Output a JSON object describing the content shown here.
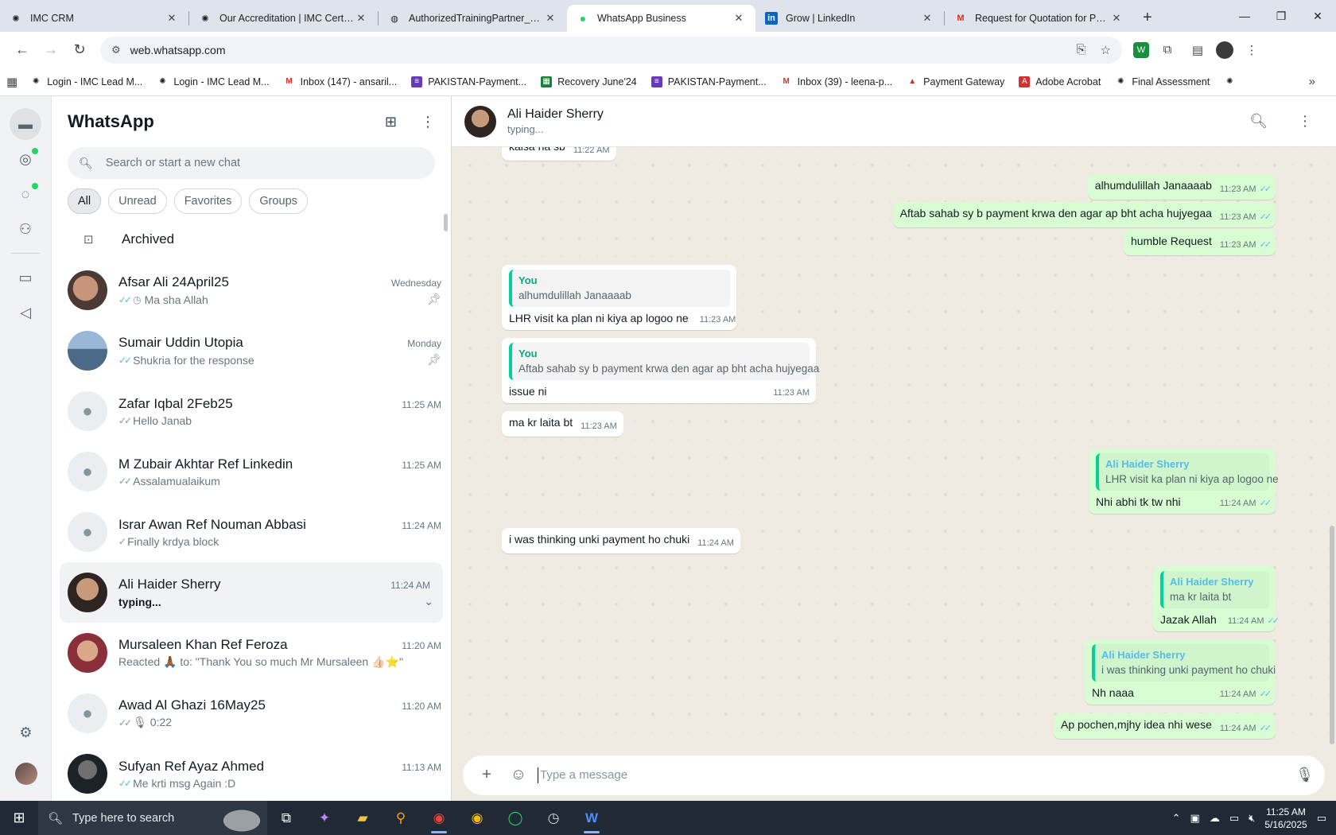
{
  "browser": {
    "tabs": [
      {
        "title": "IMC CRM",
        "icon": "spiral-icon",
        "active": false
      },
      {
        "title": "Our Accreditation | IMC Certific",
        "icon": "spiral-icon",
        "active": false
      },
      {
        "title": "AuthorizedTrainingPartner_Bad",
        "icon": "globe-icon",
        "active": false
      },
      {
        "title": "WhatsApp Business",
        "icon": "whatsapp-icon",
        "active": true
      },
      {
        "title": "Grow | LinkedIn",
        "icon": "linkedin-icon",
        "active": false
      },
      {
        "title": "Request for Quotation for PMP",
        "icon": "gmail-icon",
        "active": false
      }
    ],
    "url": "web.whatsapp.com",
    "bookmarks": [
      {
        "label": "Login - IMC Lead M...",
        "icon": "spiral-icon"
      },
      {
        "label": "Login - IMC Lead M...",
        "icon": "spiral-icon"
      },
      {
        "label": "Inbox (147) - ansaril...",
        "icon": "gmail-icon"
      },
      {
        "label": "PAKISTAN-Payment...",
        "icon": "form-icon"
      },
      {
        "label": "Recovery June'24",
        "icon": "sheet-icon"
      },
      {
        "label": "PAKISTAN-Payment...",
        "icon": "form-icon"
      },
      {
        "label": "Inbox (39) - leena-p...",
        "icon": "gmail-icon"
      },
      {
        "label": "Payment Gateway",
        "icon": "acrobat-icon"
      },
      {
        "label": "Adobe Acrobat",
        "icon": "acrobat-icon"
      },
      {
        "label": "Final Assessment",
        "icon": "spiral-icon"
      }
    ]
  },
  "sidebar": {
    "title": "WhatsApp",
    "search_placeholder": "Search or start a new chat",
    "filters": [
      "All",
      "Unread",
      "Favorites",
      "Groups"
    ],
    "archived_label": "Archived",
    "chats": [
      {
        "name": "Afsar Ali 24April25",
        "time": "Wednesday",
        "preview": "Ma sha Allah",
        "tick": "blue",
        "pinned": true,
        "avatar": "photo"
      },
      {
        "name": "Sumair Uddin Utopia",
        "time": "Monday",
        "preview": "Shukria for the response",
        "tick": "blue",
        "pinned": true,
        "avatar": "photo"
      },
      {
        "name": "Zafar Iqbal 2Feb25",
        "time": "11:25 AM",
        "preview": "Hello Janab",
        "tick": "grey",
        "pinned": false,
        "avatar": "placeholder"
      },
      {
        "name": "M Zubair Akhtar Ref Linkedin",
        "time": "11:25 AM",
        "preview": "Assalamualaikum",
        "tick": "grey",
        "pinned": false,
        "avatar": "placeholder"
      },
      {
        "name": "Israr Awan Ref Nouman Abbasi",
        "time": "11:24 AM",
        "preview": "Finally krdya block",
        "tick": "single",
        "pinned": false,
        "avatar": "placeholder"
      },
      {
        "name": "Ali Haider Sherry",
        "time": "11:24 AM",
        "preview": "typing...",
        "tick": "none",
        "pinned": false,
        "avatar": "photo",
        "selected": true
      },
      {
        "name": "Mursaleen Khan Ref Feroza",
        "time": "11:20 AM",
        "preview": "Reacted 🙏🏾 to: \"Thank You so much Mr Mursaleen 👍🏻⭐\"",
        "tick": "none",
        "pinned": false,
        "avatar": "photo"
      },
      {
        "name": "Awad Al Ghazi 16May25",
        "time": "11:20 AM",
        "preview": "🎙 0:22",
        "tick": "grey",
        "pinned": false,
        "avatar": "placeholder"
      },
      {
        "name": "Sufyan Ref Ayaz Ahmed",
        "time": "11:13 AM",
        "preview": "Me krti msg Again :D",
        "tick": "blue",
        "pinned": false,
        "avatar": "photo"
      }
    ]
  },
  "conversation": {
    "contact_name": "Ali Haider Sherry",
    "contact_status": "typing...",
    "composer_placeholder": "Type a message",
    "messages": [
      {
        "dir": "in",
        "text": "kaisa ha sb",
        "time": "11:22 AM"
      },
      {
        "dir": "out",
        "text": "alhumdulillah Janaaaab",
        "time": "11:23 AM"
      },
      {
        "dir": "out",
        "text": "Aftab sahab sy b payment krwa den agar ap bht acha hujyegaa",
        "time": "11:23 AM"
      },
      {
        "dir": "out",
        "text": "humble Request",
        "time": "11:23 AM"
      },
      {
        "dir": "in",
        "quote_name": "You",
        "quote_text": "alhumdulillah Janaaaab",
        "text": "LHR visit ka plan ni kiya ap logoo ne",
        "time": "11:23 AM"
      },
      {
        "dir": "in",
        "quote_name": "You",
        "quote_text": "Aftab sahab sy b payment krwa den agar ap bht acha hujyegaa",
        "text": "issue ni",
        "time": "11:23 AM"
      },
      {
        "dir": "in",
        "text": "ma kr laita bt",
        "time": "11:23 AM"
      },
      {
        "dir": "out",
        "quote_name": "Ali Haider Sherry",
        "quote_text": "LHR visit ka plan ni kiya ap logoo ne",
        "text": "Nhi abhi tk tw nhi",
        "time": "11:24 AM"
      },
      {
        "dir": "in",
        "text": "i was thinking unki payment ho chuki",
        "time": "11:24 AM"
      },
      {
        "dir": "out",
        "quote_name": "Ali Haider Sherry",
        "quote_text": "ma kr laita bt",
        "text": "Jazak Allah",
        "time": "11:24 AM"
      },
      {
        "dir": "out",
        "quote_name": "Ali Haider Sherry",
        "quote_text": "i was thinking unki payment ho chuki",
        "text": "Nh naaa",
        "time": "11:24 AM"
      },
      {
        "dir": "out",
        "text": "Ap pochen,mjhy idea nhi wese",
        "time": "11:24 AM"
      }
    ]
  },
  "taskbar": {
    "search_placeholder": "Type here to search",
    "time": "11:25 AM",
    "date": "5/16/2025"
  }
}
